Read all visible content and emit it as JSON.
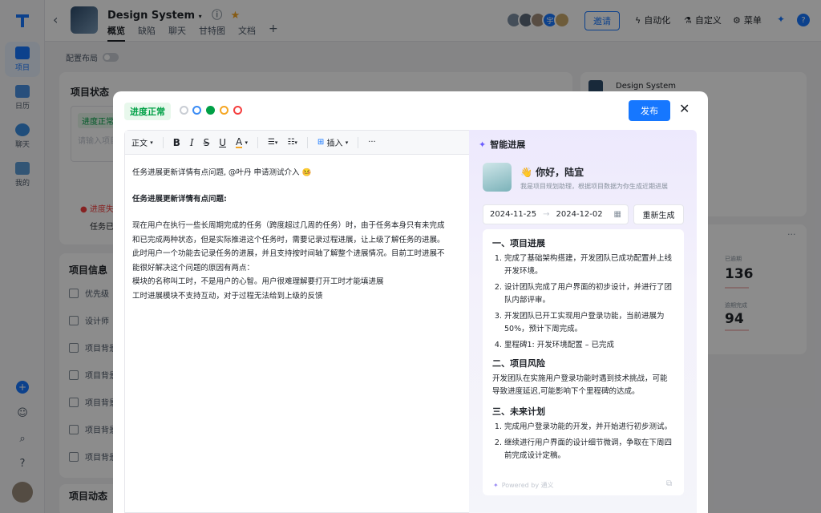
{
  "rail": {
    "items": [
      {
        "label": "项目",
        "active": true
      },
      {
        "label": "日历",
        "active": false
      },
      {
        "label": "聊天",
        "active": false
      },
      {
        "label": "我的",
        "active": false
      }
    ]
  },
  "header": {
    "project_name": "Design System",
    "tabs": [
      "概览",
      "缺陷",
      "聊天",
      "甘特图",
      "文档"
    ],
    "invite_label": "邀请",
    "avatar_text": "宇",
    "actions": [
      "自动化",
      "自定义",
      "菜单"
    ]
  },
  "background": {
    "config_label": "配置布局",
    "status_card_title": "项目状态",
    "status_badge": "进度正常",
    "status_placeholder": "请输入项目",
    "status_warning": "进度失",
    "status_text": "任务已",
    "info_card_title": "项目信息",
    "info_fields": [
      "优先级",
      "设计师",
      "项目背景",
      "项目背景",
      "项目背景",
      "项目背景",
      "项目背景"
    ],
    "activity_title": "项目动态",
    "right_card_title": "Design System",
    "stat1_label": "已逾期",
    "stat1_value": "136",
    "stat2_label": "逾期完成",
    "stat2_value": "94"
  },
  "modal": {
    "status_label": "进度正常",
    "publish_label": "发布",
    "toolbar": {
      "style_label": "正文",
      "insert_label": "插入"
    },
    "doc": {
      "intro": "任务进展更新详情有点问题, @叶丹 申请测试介入 🤒",
      "heading": "任务进展更新详情有点问题:",
      "para1_line1": "现在用户在执行一些长周期完成的任务（跨度超过几周的任务）时，由于任务本身只有未完成",
      "para1_line2": "和已完成两种状态，但是实际推进这个任务时，需要记录过程进展，让上级了解任务的进展。",
      "para1_line3": "此时用户一个功能去记录任务的进展，并且支持按时间轴了解整个进展情况。目前工时进展不",
      "para1_line4": "能很好解决这个问题的原因有两点：",
      "para1_line5": "模块的名称叫工时，不是用户的心智。用户很难理解要打开工时才能填进展",
      "para1_line6": "工时进展模块不支持互动，对于过程无法给到上级的反馈"
    },
    "ai": {
      "title": "智能进展",
      "greeting": "👋 你好，陆宜",
      "subtitle": "我是项目规划助理，根据项目数据为你生成近期进展",
      "date_start": "2024-11-25",
      "date_sep": "→",
      "date_end": "2024-12-02",
      "regen_label": "重新生成",
      "section1_title": "一、项目进展",
      "section1_items": [
        "完成了基础架构搭建，开发团队已成功配置并上线开发环境。",
        "设计团队完成了用户界面的初步设计，并进行了团队内部评审。",
        "开发团队已开工实现用户登录功能，当前进展为50%，预计下周完成。",
        "里程碑1: 开发环境配置 – 已完成"
      ],
      "section2_title": "二、项目风险",
      "section2_text": "开发团队在实施用户登录功能时遇到技术挑战，可能导致进度延迟,可能影响下个里程碑的达成。",
      "section3_title": "三、未来计划",
      "section3_items": [
        "完成用户登录功能的开发，并开始进行初步测试。",
        "继续进行用户界面的设计细节微调，争取在下周四前完成设计定稿。"
      ],
      "powered": "Powered by 通义"
    }
  },
  "colors": {
    "accent": "#1677ff",
    "success": "#00a046",
    "warning": "#f5a623",
    "danger": "#f53f3f"
  }
}
